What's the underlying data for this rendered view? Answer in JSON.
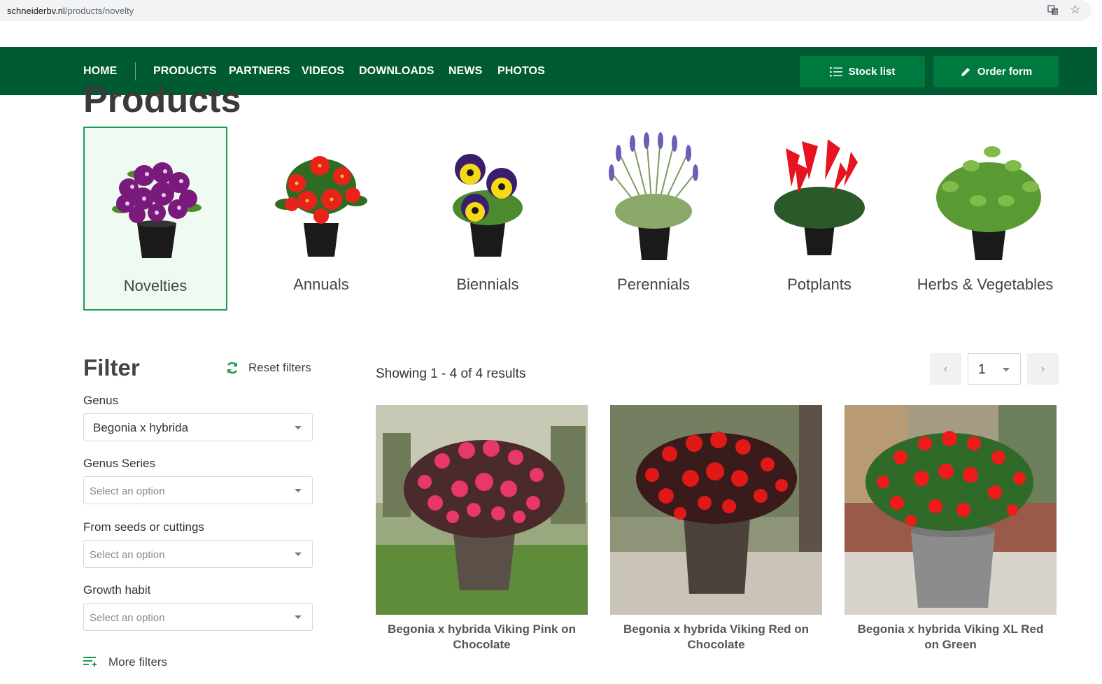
{
  "browser": {
    "url_domain": "schneiderbv.nl",
    "url_path": "/products/novelty"
  },
  "nav": {
    "links": [
      "HOME",
      "PRODUCTS",
      "PARTNERS",
      "VIDEOS",
      "DOWNLOADS",
      "NEWS",
      "PHOTOS"
    ],
    "stock_list": "Stock list",
    "order_form": "Order form",
    "color": "#005a32"
  },
  "page": {
    "title": "Products"
  },
  "categories": [
    {
      "label": "Novelties",
      "active": true
    },
    {
      "label": "Annuals",
      "active": false
    },
    {
      "label": "Biennials",
      "active": false
    },
    {
      "label": "Perennials",
      "active": false
    },
    {
      "label": "Potplants",
      "active": false
    },
    {
      "label": "Herbs & Vegetables",
      "active": false
    }
  ],
  "filter": {
    "title": "Filter",
    "reset": "Reset filters",
    "genus": {
      "label": "Genus",
      "value": "Begonia x hybrida"
    },
    "genus_series": {
      "label": "Genus Series",
      "placeholder": "Select an option"
    },
    "seeds_cuttings": {
      "label": "From seeds or cuttings",
      "placeholder": "Select an option"
    },
    "growth_habit": {
      "label": "Growth habit",
      "placeholder": "Select an option"
    },
    "more": "More filters"
  },
  "results": {
    "showing": "Showing 1 - 4 of 4 results",
    "page": "1",
    "products": [
      {
        "name": "Begonia x hybrida Viking Pink on Chocolate"
      },
      {
        "name": "Begonia x hybrida Viking Red on Chocolate"
      },
      {
        "name": "Begonia x hybrida Viking XL Red on Green"
      }
    ]
  }
}
